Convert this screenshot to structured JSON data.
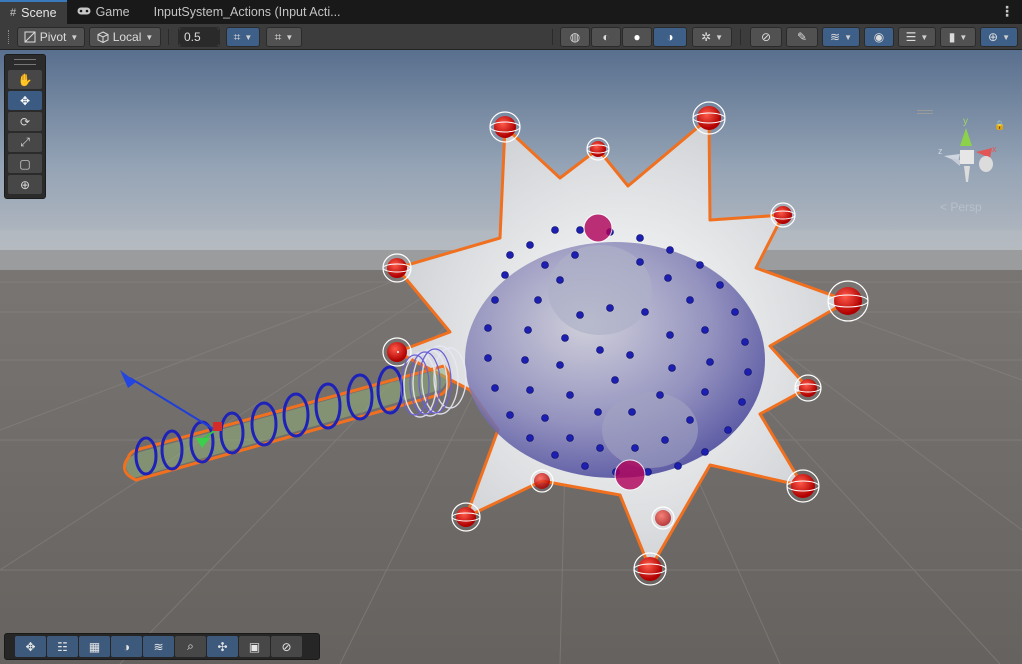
{
  "tabs": [
    {
      "label": "Scene",
      "icon": "grid-icon",
      "active": true
    },
    {
      "label": "Game",
      "icon": "gamepad-icon",
      "active": false
    },
    {
      "label": "InputSystem_Actions (Input Acti...",
      "icon": "",
      "active": false
    }
  ],
  "toolbar": {
    "pivot_label": "Pivot",
    "space_label": "Local",
    "snap_value": "0.5"
  },
  "scene": {
    "camera_mode": "Persp"
  },
  "colors": {
    "selection_outline": "#f07020",
    "sky_top": "#5f7fa5",
    "ground": "#6d6865",
    "toolbar_active": "#3e5f87"
  },
  "tools": [
    {
      "name": "hand-tool",
      "glyph": "✋"
    },
    {
      "name": "move-tool",
      "glyph": "✥"
    },
    {
      "name": "rotate-tool",
      "glyph": "⟳"
    },
    {
      "name": "scale-tool",
      "glyph": "⤢"
    },
    {
      "name": "rect-tool",
      "glyph": "▢"
    },
    {
      "name": "transform-tool",
      "glyph": "⊕"
    }
  ]
}
